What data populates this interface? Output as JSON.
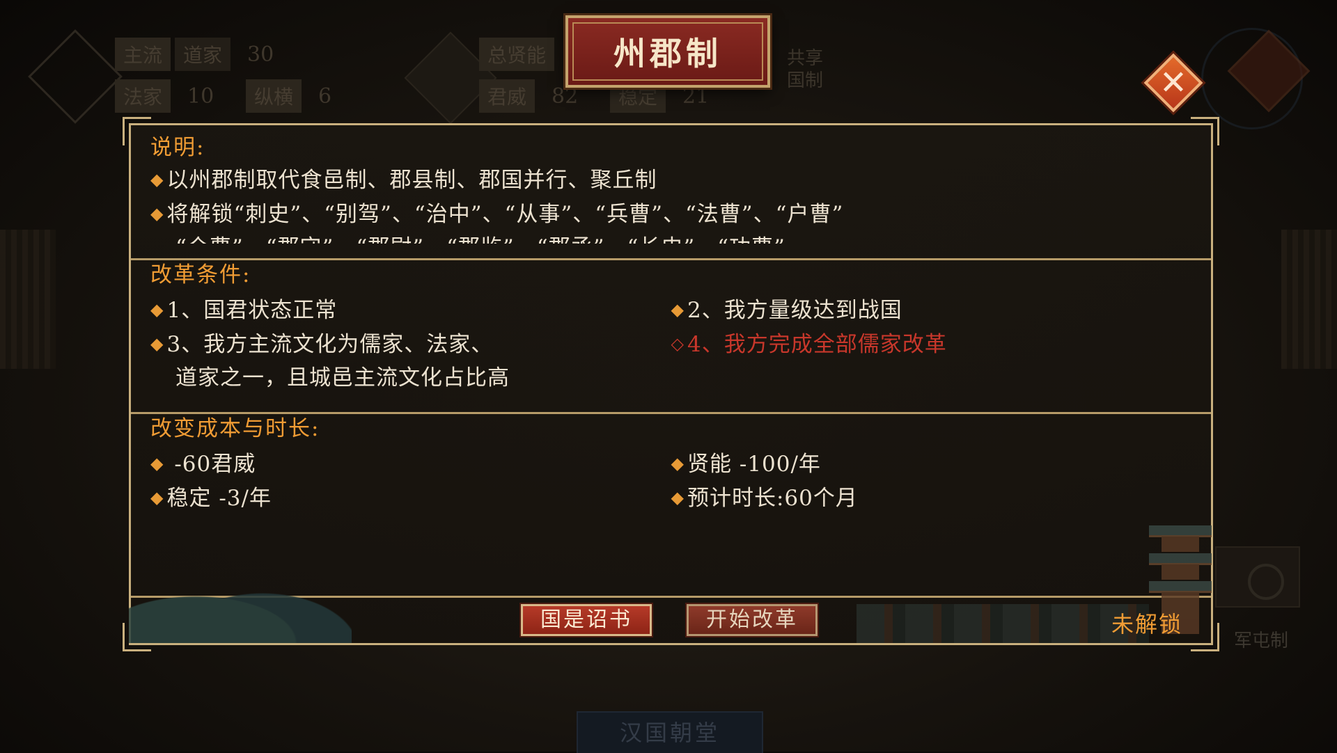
{
  "title": "州郡制",
  "close_icon": "close-icon",
  "background": {
    "stat_rows": [
      [
        {
          "tag": "主流",
          "value": ""
        },
        {
          "tag": "道家",
          "value": "30"
        }
      ],
      [
        {
          "tag": "法家",
          "value": "10"
        },
        {
          "tag": "纵横",
          "value": "6"
        }
      ]
    ],
    "stat_rows_2": [
      [
        {
          "tag": "总贤能",
          "value": ""
        }
      ],
      [
        {
          "tag": "君威",
          "value": "82"
        },
        {
          "tag": "稳定",
          "value": "21"
        }
      ]
    ],
    "side_tag": "共享国制",
    "courtyard_title": "汉国朝堂",
    "right_tag": "军屯制"
  },
  "sections": {
    "description": {
      "title": "说明:",
      "lines": [
        "以州郡制取代食邑制、郡县制、郡国并行、聚丘制",
        "将解锁“刺史”、“别驾”、“治中”、“从事”、“兵曹”、“法曹”、“户曹”",
        "“仓曹”、“郡守”、“郡尉”、“郡监”、“郡丞”、“长史”、“功曹”"
      ]
    },
    "conditions": {
      "title": "改革条件:",
      "items": [
        {
          "text": "1、国君状态正常",
          "met": true
        },
        {
          "text": "2、我方量级达到战国",
          "met": true
        },
        {
          "text": "3、我方主流文化为儒家、法家、",
          "cont": "道家之一，且城邑主流文化占比高",
          "met": true
        },
        {
          "text": "4、我方完成全部儒家改革",
          "met": false
        }
      ]
    },
    "cost": {
      "title": "改变成本与时长:",
      "items": [
        " -60君威",
        "贤能 -100/年",
        "稳定 -3/年",
        "预计时长:60个月"
      ]
    }
  },
  "buttons": {
    "edict": "国是诏书",
    "reform": "开始改革"
  },
  "status": "未解锁",
  "colors": {
    "accent": "#f09c34",
    "unmet": "#c8372b",
    "panel_border": "#c9b07e",
    "button_red": "#b63a28"
  }
}
